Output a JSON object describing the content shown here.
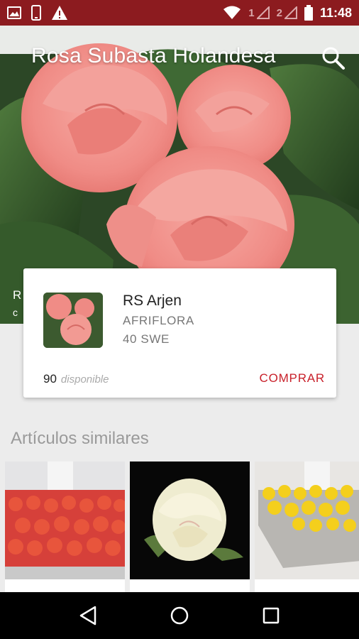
{
  "status_bar": {
    "time": "11:48",
    "sim1": "1",
    "sim2": "2",
    "icons": [
      "image-notification-icon",
      "phone-icon",
      "warning-icon",
      "wifi-icon",
      "signal-icon",
      "battery-icon"
    ]
  },
  "header": {
    "title": "Rosa Subasta Holandesa",
    "search_icon": "search-icon",
    "hidden_side_initial": "R",
    "hidden_side_initial_2": "c"
  },
  "product": {
    "name": "RS Arjen",
    "grower": "AFRIFLORA",
    "spec": "40 SWE",
    "available_count": "90",
    "available_label": "disponible",
    "buy_label": "COMPRAR"
  },
  "similar": {
    "title": "Artículos similares",
    "items": [
      {
        "thumb": "red-roses-bucket"
      },
      {
        "thumb": "cream-rose"
      },
      {
        "thumb": "yellow-flowers-box"
      }
    ]
  },
  "nav": {
    "icons": [
      "back-icon",
      "home-icon",
      "recents-icon"
    ]
  },
  "colors": {
    "status_bar": "#8c1b1f",
    "accent": "#c8202a",
    "background": "#ececec"
  }
}
